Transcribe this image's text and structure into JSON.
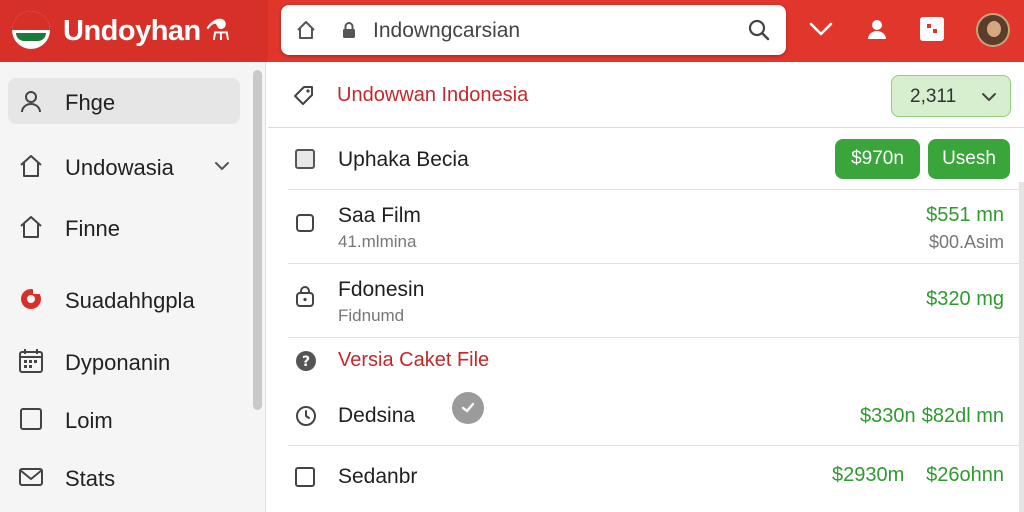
{
  "header": {
    "brand": "Undoyhan",
    "brand_symbol": "⚗",
    "search_text": "Indowngcarsian",
    "icons": [
      "home-icon",
      "lock-icon",
      "search-icon",
      "chevron-down-icon",
      "user-icon",
      "card-icon",
      "avatar"
    ]
  },
  "sidebar": {
    "items": [
      {
        "label": "Fhge",
        "icon": "user-icon",
        "active": true
      },
      {
        "label": "Undowasia",
        "icon": "home-icon",
        "expandable": true
      },
      {
        "label": "Finne",
        "icon": "home-icon"
      },
      {
        "label": "Suadahhgpla",
        "icon": "gear-icon"
      },
      {
        "label": "Dyponanin",
        "icon": "calendar-icon"
      },
      {
        "label": "Loim",
        "icon": "square-icon"
      },
      {
        "label": "Stats",
        "icon": "mail-icon"
      }
    ]
  },
  "main": {
    "title": "Undowwan Indonesia",
    "select_value": "2,311",
    "rows": [
      {
        "name": "Uphaka Becia",
        "buttons": [
          "$970n",
          "Usesh"
        ]
      },
      {
        "name": "Saa Film",
        "sub": "41.mlmina",
        "amount": "$551 mn",
        "amount2": "$00.Asim"
      },
      {
        "name": "Fdonesin",
        "sub": "Fidnumd",
        "amount": "$320 mg"
      },
      {
        "link": "Versia Caket File"
      },
      {
        "name": "Dedsina",
        "amount_a": "$330n",
        "amount_b": "$82dl mn"
      },
      {
        "name": "Sedanbr",
        "amount_a": "$2930m",
        "amount_b": "$26ohnn"
      }
    ]
  },
  "colors": {
    "accent": "#e0362c",
    "green": "#3aa53a",
    "link_red": "#c62828"
  }
}
